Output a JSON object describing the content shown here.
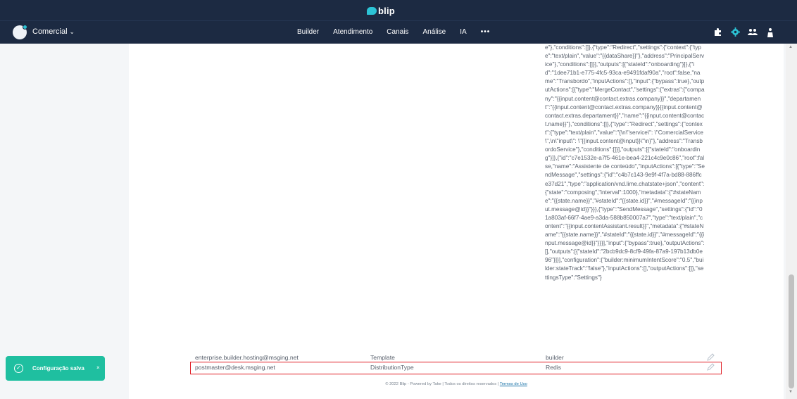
{
  "brand": {
    "name": "blip"
  },
  "header": {
    "tenant": "Comercial",
    "nav": [
      "Builder",
      "Atendimento",
      "Canais",
      "Análise",
      "IA",
      "•••"
    ],
    "icons": [
      "puzzle-icon",
      "settings-icon",
      "team-icon",
      "account-icon"
    ]
  },
  "json_value": "e\"},\"conditions\":[]},{\"type\":\"Redirect\",\"settings\":{\"context\":{\"type\":\"text/plain\",\"value\":\"{{dataShare}}\"},\"address\":\"PrincipalService\"},\"conditions\":[]}],\"outputs\":[{\"stateId\":\"onboarding\"}]},{\"id\":\"1dee71b1-e775-4fc5-93ca-e9491fdaf90a\",\"root\":false,\"name\":\"Transbordo\",\"inputActions\":[],\"input\":{\"bypass\":true},\"outputActions\":[{\"type\":\"MergeContact\",\"settings\":{\"extras\":{\"company\":\"{{input.content@contact.extras.company}}\",\"departament\":\"{{input.content@contact.extras.company}}{{input.content@contact.extras.departament}}\",\"name\":\"{{input.content@contact.name}}\"},\"conditions\":[]},{\"type\":\"Redirect\",\"settings\":{\"context\":{\"type\":\"text/plain\",\"value\":\"{\\n\\\"service\\\": \\\"ComercialService\\\",\\n\\\"input\\\": \\\"{{input.content@input}}\\\"\\n}\"},\"address\":\"TransbordoService\"},\"conditions\":[]}],\"outputs\":[{\"stateId\":\"onboarding\"}]},{\"id\":\"c7e1532e-a7f5-461e-bea4-221c4c9e0c86\",\"root\":false,\"name\":\"Assistente de conteúdo\",\"inputActions\":[{\"type\":\"SendMessage\",\"settings\":{\"id\":\"c4b7c143-9e9f-4f7a-bd88-886ffce37d21\",\"type\":\"application/vnd.lime.chatstate+json\",\"content\":{\"state\":\"composing\",\"interval\":1000},\"metadata\":{\"#stateName\":\"{{state.name}}\",\"#stateId\":\"{{state.id}}\",\"#messageId\":\"{{input.message@id}}\"}}},{\"type\":\"SendMessage\",\"settings\":{\"id\":\"01a803af-66f7-4ae9-a3da-588b850007a7\",\"type\":\"text/plain\",\"content\":\"{{input.contentAssistant.result}}\",\"metadata\":{\"#stateName\":\"{{state.name}}\",\"#stateId\":\"{{state.id}}\",\"#messageId\":\"{{input.message@id}}\"}}}],\"input\":{\"bypass\":true},\"outputActions\":[],\"outputs\":[{\"stateId\":\"2bcb9dc9-8cf9-49fa-87a9-197b13db0e96\"}]}],\"configuration\":{\"builder:minimumIntentScore\":\"0.5\",\"builder:stateTrack\":\"false\"},\"inputActions\":[],\"outputActions\":[]},\"settingsType\":\"Settings\"}",
  "rows": [
    {
      "identity": "enterprise.builder.hosting@msging.net",
      "key": "Template",
      "value": "builder"
    },
    {
      "identity": "postmaster@desk.msging.net",
      "key": "DistributionType",
      "value": "Redis"
    }
  ],
  "footer": {
    "text": "© 2022 Blip - Powered by Take | Todos os direitos reservados |",
    "link": "Termos de Uso"
  },
  "toast": {
    "message": "Configuração salva",
    "close": "×"
  },
  "colors": {
    "header": "#1c2a42",
    "accent": "#2cc3d5",
    "toast": "#1fbfa0",
    "highlight": "#e01b22"
  }
}
